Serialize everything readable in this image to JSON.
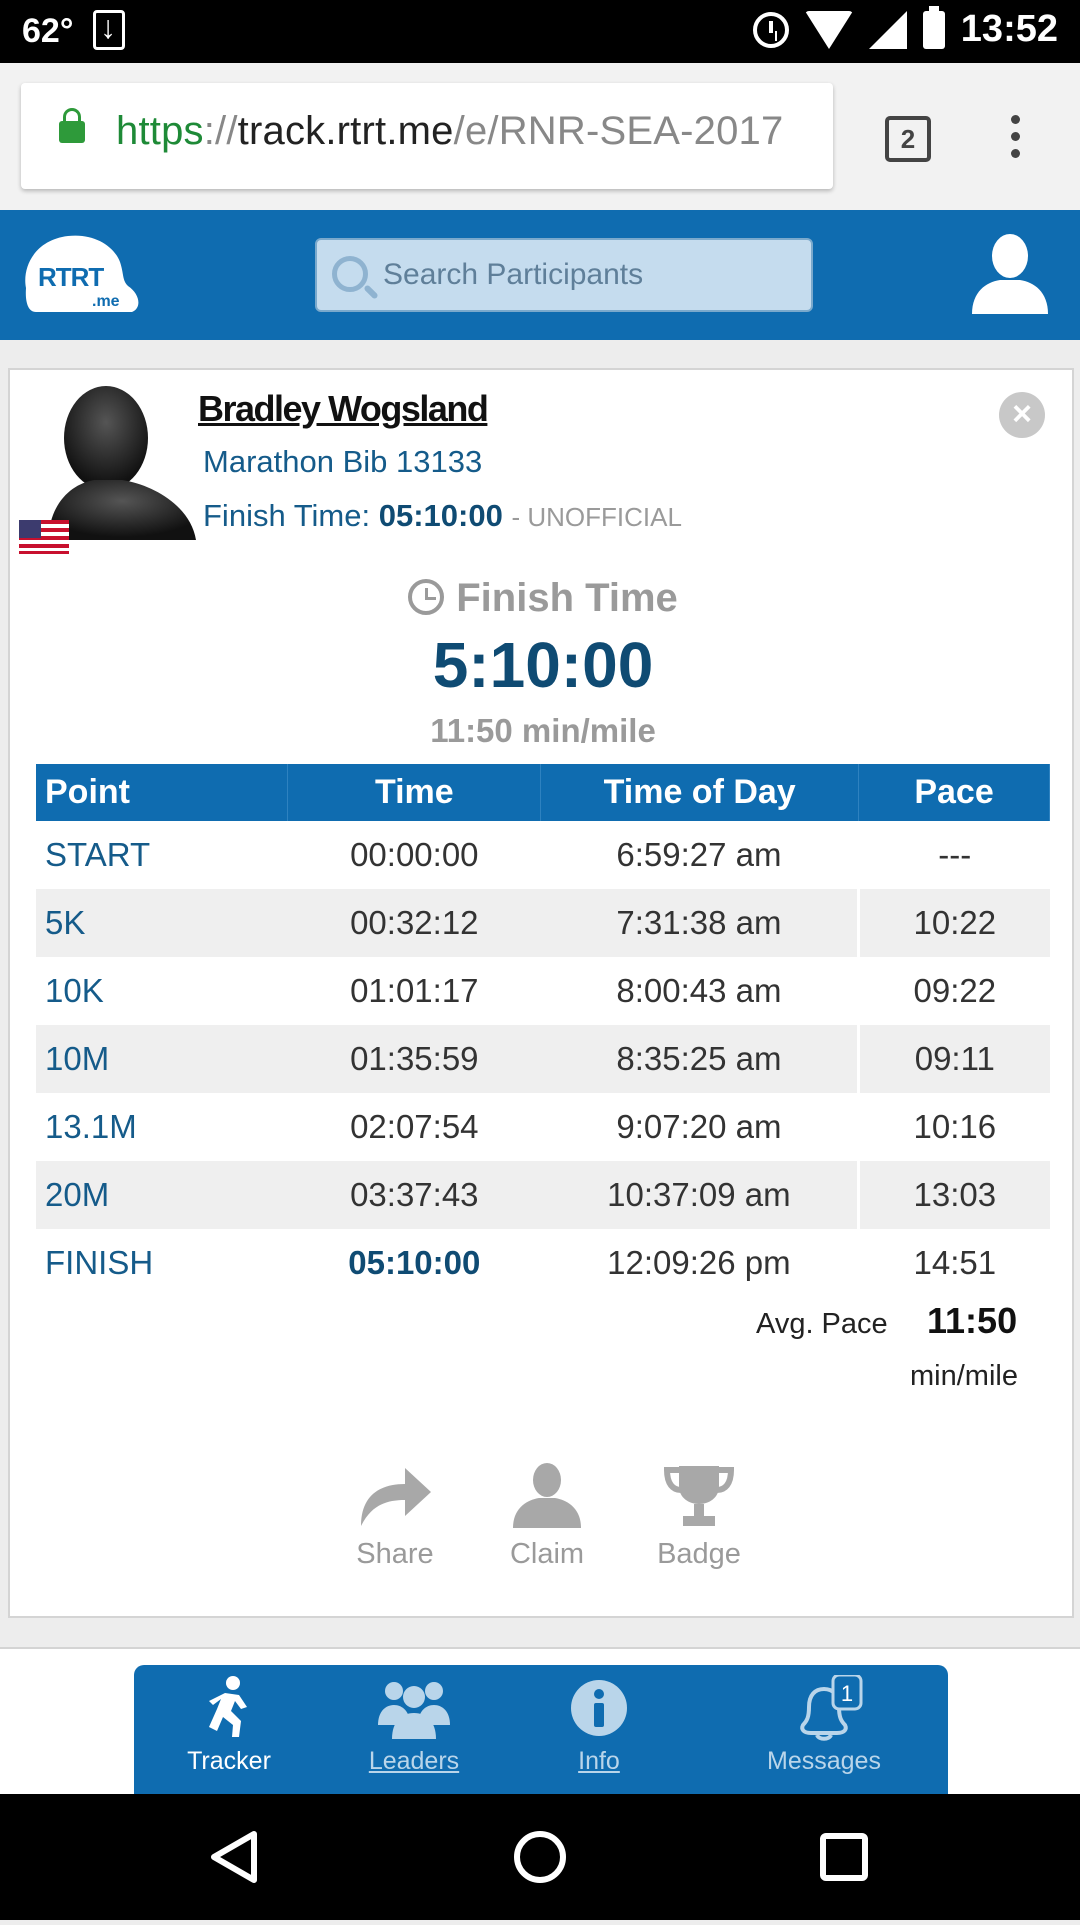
{
  "status_bar": {
    "temperature": "62°",
    "clock": "13:52"
  },
  "browser": {
    "url_scheme": "https",
    "url_sep": "://",
    "url_host": "track.rtrt.me",
    "url_path": "/e/RNR-SEA-2017",
    "tab_count": "2"
  },
  "header": {
    "logo_text_top": "RTRT",
    "logo_text_bottom": ".me",
    "search_placeholder": "Search Participants"
  },
  "participant": {
    "name": "Bradley Wogsland",
    "bib": "Marathon Bib 13133",
    "finish_label": "Finish Time:",
    "finish_value": "05:10:00",
    "finish_status": "- UNOFFICIAL"
  },
  "summary": {
    "heading": "Finish Time",
    "big_time": "5:10:00",
    "pace": "11:50 min/mile"
  },
  "splits": {
    "headers": [
      "Point",
      "Time",
      "Time of Day",
      "Pace"
    ],
    "rows": [
      {
        "point": "START",
        "time": "00:00:00",
        "tod": "6:59:27 am",
        "pace": "---"
      },
      {
        "point": "5K",
        "time": "00:32:12",
        "tod": "7:31:38 am",
        "pace": "10:22"
      },
      {
        "point": "10K",
        "time": "01:01:17",
        "tod": "8:00:43 am",
        "pace": "09:22"
      },
      {
        "point": "10M",
        "time": "01:35:59",
        "tod": "8:35:25 am",
        "pace": "09:11"
      },
      {
        "point": "13.1M",
        "time": "02:07:54",
        "tod": "9:07:20 am",
        "pace": "10:16"
      },
      {
        "point": "20M",
        "time": "03:37:43",
        "tod": "10:37:09 am",
        "pace": "13:03"
      },
      {
        "point": "FINISH",
        "time": "05:10:00",
        "tod": "12:09:26 pm",
        "pace": "14:51"
      }
    ],
    "avg_label": "Avg. Pace",
    "avg_value": "11:50",
    "avg_unit": "min/mile"
  },
  "actions": {
    "share": "Share",
    "claim": "Claim",
    "badge": "Badge"
  },
  "tabs": {
    "tracker": "Tracker",
    "leaders": "Leaders",
    "info": "Info",
    "messages": "Messages",
    "messages_badge": "1"
  },
  "colors": {
    "brand_blue": "#0f6cb0",
    "dark_text_blue": "#0f4b73",
    "url_green": "#1e8a37"
  }
}
